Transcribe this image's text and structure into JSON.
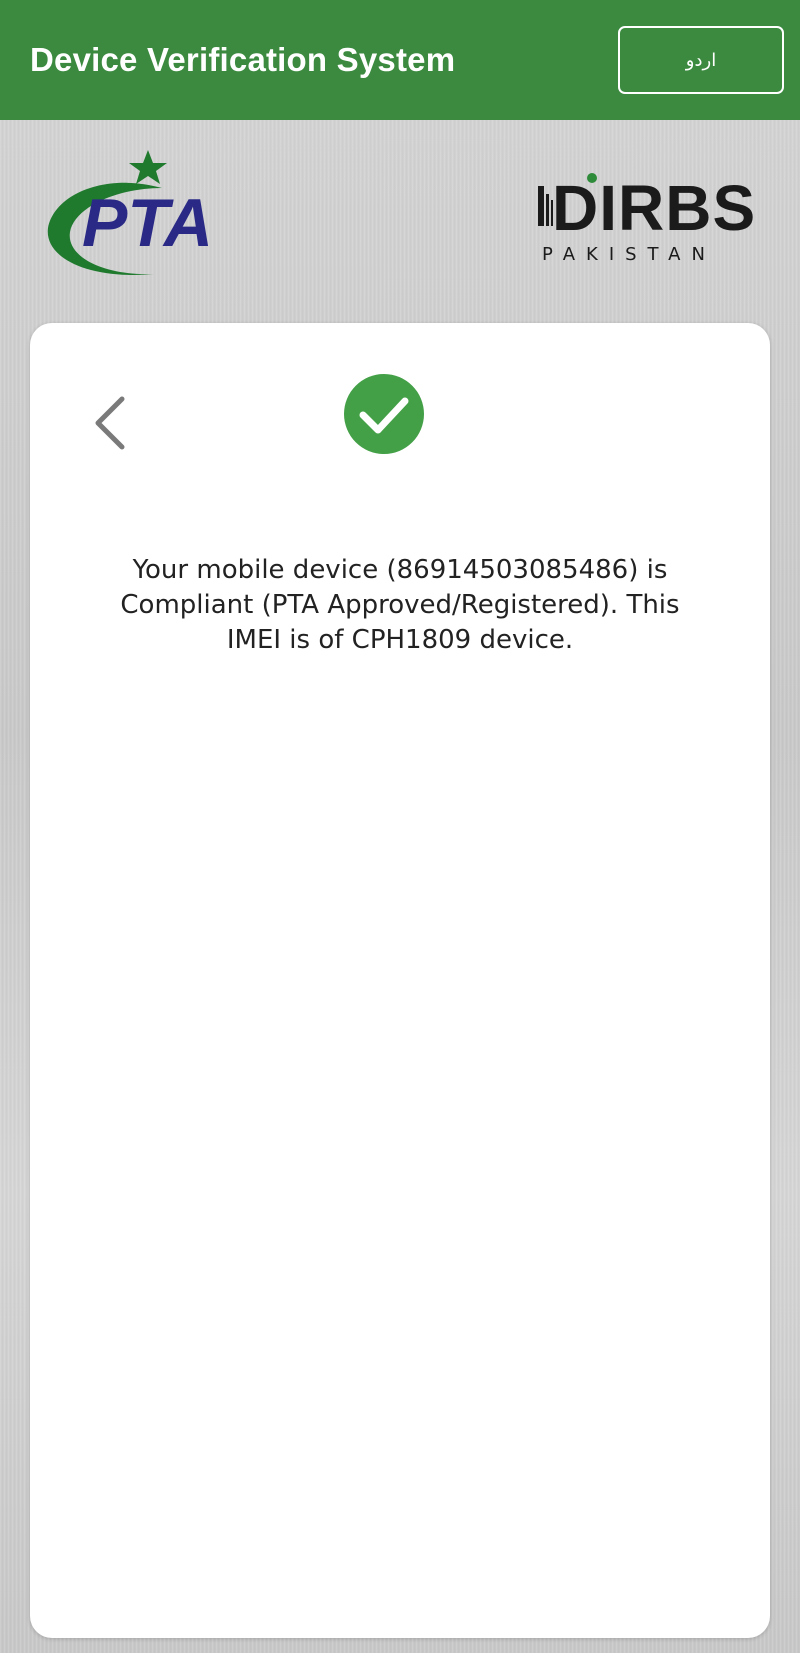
{
  "appbar": {
    "title": "Device Verification System",
    "language_button": "اردو",
    "color": "#3b8a3f"
  },
  "logos": {
    "pta": {
      "text": "PTA",
      "icon": "pta-logo-icon"
    },
    "dirbs": {
      "text": "DIRBS",
      "subtext": "PAKISTAN",
      "icon": "dirbs-logo-icon"
    }
  },
  "result": {
    "status_icon": "check-circle-icon",
    "status_color": "#43a047",
    "back_icon": "chevron-left-icon",
    "message": "Your mobile device (86914503085486) is Compliant (PTA Approved/Registered). This IMEI is of CPH1809 device."
  }
}
